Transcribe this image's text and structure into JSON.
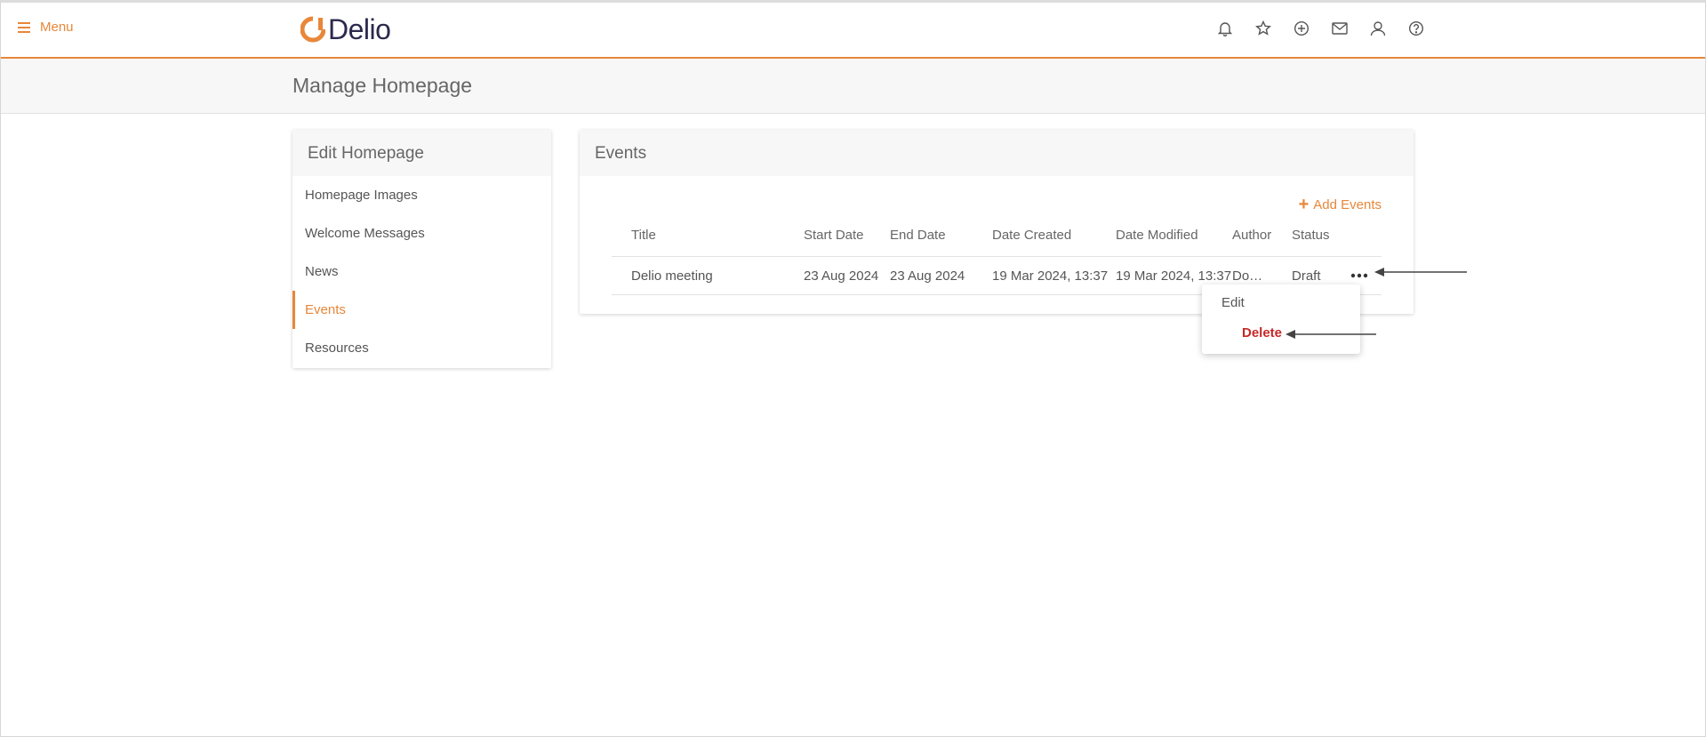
{
  "header": {
    "menu_label": "Menu",
    "logo_text": "Delio",
    "icons": [
      "bell-icon",
      "star-icon",
      "plus-circle-icon",
      "mail-icon",
      "user-icon",
      "help-icon"
    ]
  },
  "page": {
    "title": "Manage Homepage"
  },
  "sidebar": {
    "title": "Edit Homepage",
    "items": [
      {
        "label": "Homepage Images"
      },
      {
        "label": "Welcome Messages"
      },
      {
        "label": "News"
      },
      {
        "label": "Events"
      },
      {
        "label": "Resources"
      }
    ],
    "active": "Events"
  },
  "events": {
    "title": "Events",
    "add_label": "Add Events",
    "columns": [
      "Title",
      "Start Date",
      "End Date",
      "Date Created",
      "Date Modified",
      "Author",
      "Status"
    ],
    "rows": [
      {
        "title": "Delio meeting",
        "start": "23 Aug 2024",
        "end": "23 Aug 2024",
        "created": "19 Mar 2024, 13:37",
        "modified": "19 Mar 2024, 13:37",
        "author": "Do…",
        "status": "Draft"
      }
    ]
  },
  "dropdown": {
    "edit_label": "Edit",
    "delete_label": "Delete"
  },
  "colors": {
    "accent": "#e8873a",
    "danger": "#c62828",
    "logo_dark": "#2b2a4c"
  }
}
